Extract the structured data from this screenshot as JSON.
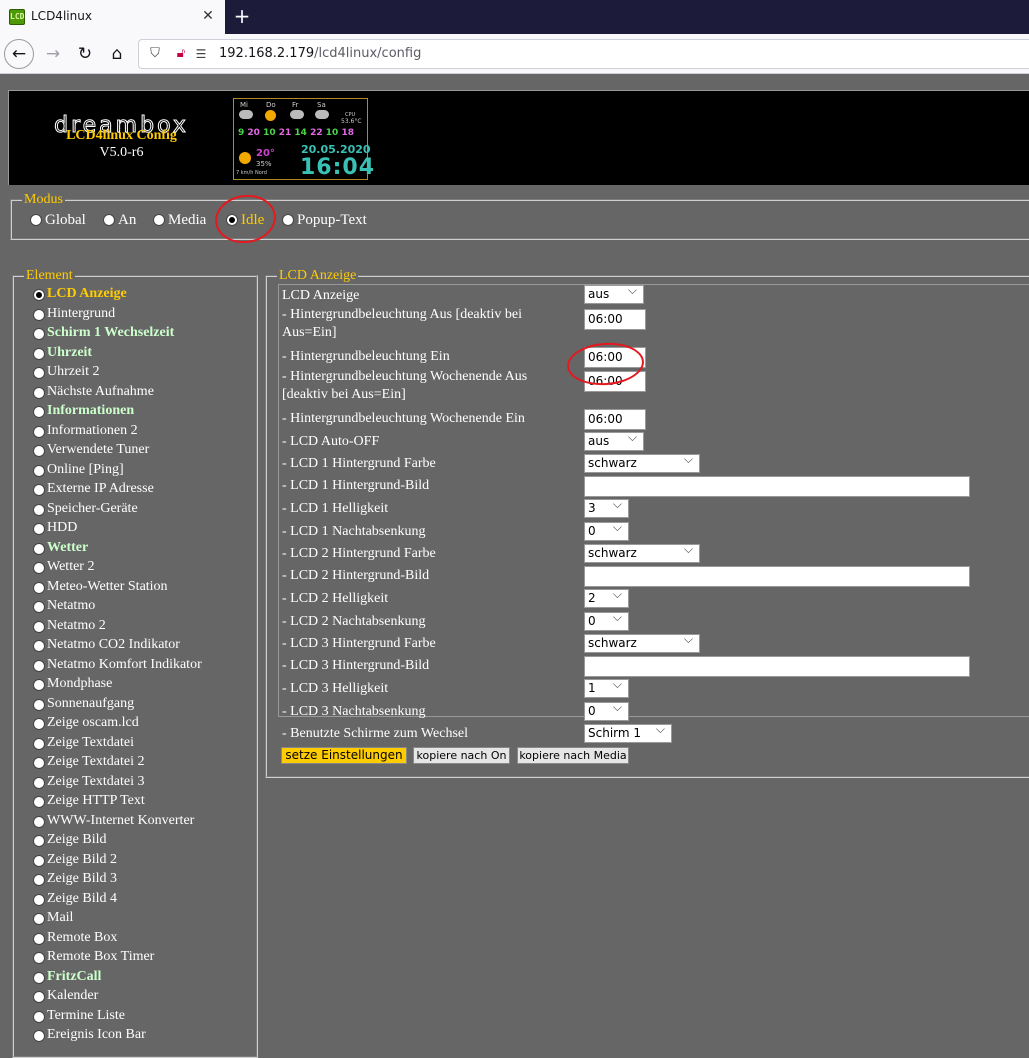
{
  "browser": {
    "tab_title": "LCD4linux",
    "favicon_text": "LCD",
    "close_glyph": "✕",
    "new_tab_glyph": "+",
    "url_host": "192.168.2.179",
    "url_path": "/lcd4linux/config"
  },
  "header": {
    "logo": "dreambox",
    "title": "LCD4linux Config",
    "version": "V5.0-r6"
  },
  "lcd_preview": {
    "days": [
      "Mi",
      "Do",
      "Fr",
      "Sa"
    ],
    "forecast": [
      {
        "hi": "9",
        "lo": "20"
      },
      {
        "hi": "10",
        "lo": "21"
      },
      {
        "hi": "14",
        "lo": "22"
      },
      {
        "hi": "10",
        "lo": "18"
      }
    ],
    "cpu_label": "CPU",
    "cpu_temp": "53.6°C",
    "current_temp": "20°",
    "humidity": "35%",
    "wind": "7 km/h Nord",
    "date": "20.05.2020",
    "time": "16:04"
  },
  "modus": {
    "legend": "Modus",
    "options": [
      "Global",
      "An",
      "Media",
      "Idle",
      "Popup-Text"
    ],
    "selected": "Idle"
  },
  "element": {
    "legend": "Element",
    "items": [
      "LCD Anzeige",
      "Hintergrund",
      "Schirm 1 Wechselzeit",
      "Uhrzeit",
      "Uhrzeit 2",
      "Nächste Aufnahme",
      "Informationen",
      "Informationen 2",
      "Verwendete Tuner",
      "Online [Ping]",
      "Externe IP Adresse",
      "Speicher-Geräte",
      "HDD",
      "Wetter",
      "Wetter 2",
      "Meteo-Wetter Station",
      "Netatmo",
      "Netatmo 2",
      "Netatmo CO2 Indikator",
      "Netatmo Komfort Indikator",
      "Mondphase",
      "Sonnenaufgang",
      "Zeige oscam.lcd",
      "Zeige Textdatei",
      "Zeige Textdatei 2",
      "Zeige Textdatei 3",
      "Zeige HTTP Text",
      "WWW-Internet Konverter",
      "Zeige Bild",
      "Zeige Bild 2",
      "Zeige Bild 3",
      "Zeige Bild 4",
      "Mail",
      "Remote Box",
      "Remote Box Timer",
      "FritzCall",
      "Kalender",
      "Termine Liste",
      "Ereignis Icon Bar"
    ],
    "selected": "LCD Anzeige",
    "bold": [
      "Schirm 1 Wechselzeit",
      "Uhrzeit",
      "Informationen",
      "Wetter",
      "FritzCall"
    ]
  },
  "lcd_anzeige": {
    "legend": "LCD Anzeige",
    "rows": [
      {
        "label": "LCD Anzeige",
        "type": "select",
        "value": "aus"
      },
      {
        "label": "- Hintergrundbeleuchtung Aus [deaktiv bei Aus=Ein]",
        "type": "input",
        "value": "06:00"
      },
      {
        "label": "- Hintergrundbeleuchtung Ein",
        "type": "input",
        "value": "06:00"
      },
      {
        "label": "- Hintergrundbeleuchtung Wochenende Aus [deaktiv bei Aus=Ein]",
        "type": "input",
        "value": "06:00"
      },
      {
        "label": "- Hintergrundbeleuchtung Wochenende Ein",
        "type": "input",
        "value": "06:00"
      },
      {
        "label": "- LCD Auto-OFF",
        "type": "select",
        "value": "aus"
      },
      {
        "label": "- LCD 1 Hintergrund Farbe",
        "type": "select",
        "value": "schwarz"
      },
      {
        "label": "- LCD 1 Hintergrund-Bild",
        "type": "input",
        "value": ""
      },
      {
        "label": "- LCD 1 Helligkeit",
        "type": "select",
        "value": "3"
      },
      {
        "label": "- LCD 1 Nachtabsenkung",
        "type": "select",
        "value": "0"
      },
      {
        "label": "- LCD 2 Hintergrund Farbe",
        "type": "select",
        "value": "schwarz"
      },
      {
        "label": "- LCD 2 Hintergrund-Bild",
        "type": "input",
        "value": ""
      },
      {
        "label": "- LCD 2 Helligkeit",
        "type": "select",
        "value": "2"
      },
      {
        "label": "- LCD 2 Nachtabsenkung",
        "type": "select",
        "value": "0"
      },
      {
        "label": "- LCD 3 Hintergrund Farbe",
        "type": "select",
        "value": "schwarz"
      },
      {
        "label": "- LCD 3 Hintergrund-Bild",
        "type": "input",
        "value": ""
      },
      {
        "label": "- LCD 3 Helligkeit",
        "type": "select",
        "value": "1"
      },
      {
        "label": "- LCD 3 Nachtabsenkung",
        "type": "select",
        "value": "0"
      },
      {
        "label": "- Benutzte Schirme zum Wechsel",
        "type": "select",
        "value": "Schirm 1"
      }
    ]
  },
  "buttons": {
    "apply": "setze Einstellungen",
    "copy_on": "kopiere nach On",
    "copy_media": "kopiere nach Media"
  },
  "colors": {
    "accent": "#ffcc00",
    "highlight_circle": "#e4191f",
    "page_bg": "#666666"
  }
}
